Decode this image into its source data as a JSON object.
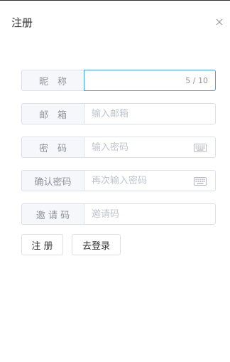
{
  "dialog": {
    "title": "注册",
    "close_icon": "close-icon"
  },
  "form": {
    "nickname": {
      "label": "昵　称",
      "value": "",
      "count": "5 / 10"
    },
    "email": {
      "label": "邮　箱",
      "placeholder": "输入邮箱"
    },
    "password": {
      "label": "密　码",
      "placeholder": "输入密码",
      "icon": "keyboard-icon"
    },
    "confirm": {
      "label": "确认密码",
      "placeholder": "再次输入密码",
      "icon": "keyboard-icon"
    },
    "invite": {
      "label": "邀 请 码",
      "placeholder": "邀请码"
    }
  },
  "actions": {
    "register_label": "注 册",
    "login_label": "去登录"
  },
  "colors": {
    "active_border": "#409eff",
    "border": "#dcdfe6",
    "label_bg": "#f5f7fa"
  }
}
